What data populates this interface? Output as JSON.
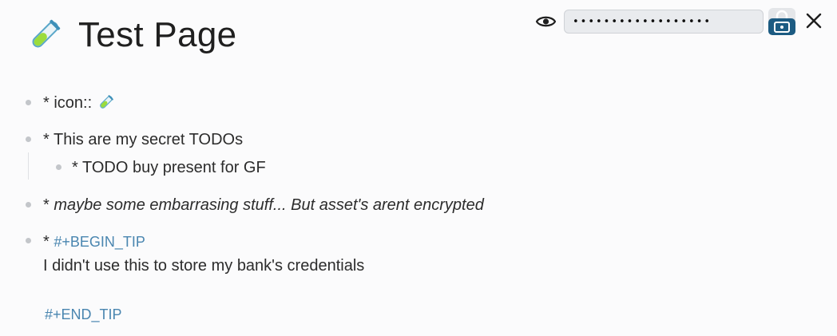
{
  "page": {
    "title": "Test Page",
    "title_icon": "test-tube-icon"
  },
  "toolbar": {
    "password_value": "••••••••••••••••••",
    "eye_icon": "eye-icon",
    "lock_icon": "lock-icon",
    "close_icon": "close-icon",
    "accent_color": "#1c5b82"
  },
  "blocks": [
    {
      "text": "* icon:: ",
      "icon": "test-tube-icon"
    },
    {
      "text": "* This are my secret TODOs"
    },
    {
      "text": "* TODO buy present for GF"
    },
    {
      "text": "* ",
      "italic_text": "maybe some embarrasing stuff... But asset's arent encrypted"
    },
    {
      "prefix": "* ",
      "begin_tag": "#+BEGIN_TIP",
      "body": "I didn't use this to store my bank's credentials",
      "end_tag": "#+END_TIP"
    }
  ]
}
